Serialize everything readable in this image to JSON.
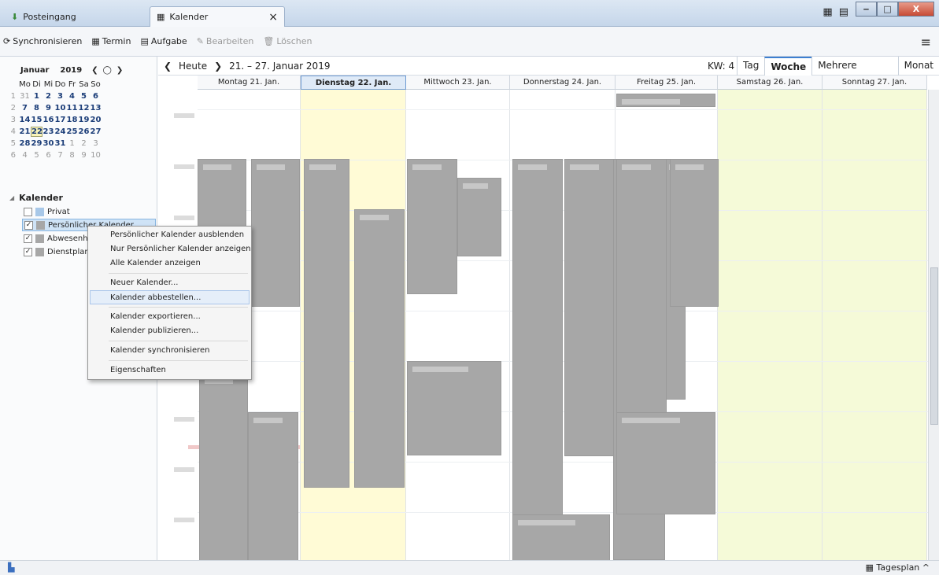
{
  "tabs": {
    "inbox": "Posteingang",
    "calendar": "Kalender",
    "close": "×"
  },
  "toolbar": {
    "sync": "Synchronisieren",
    "event": "Termin",
    "task": "Aufgabe",
    "edit": "Bearbeiten",
    "delete": "Löschen"
  },
  "minimonth": {
    "month": "Januar",
    "year": "2019",
    "weekdays": [
      "Mo",
      "Di",
      "Mi",
      "Do",
      "Fr",
      "Sa",
      "So"
    ],
    "weeks": [
      {
        "wk": "1",
        "days": [
          "31",
          "1",
          "2",
          "3",
          "4",
          "5",
          "6"
        ]
      },
      {
        "wk": "2",
        "days": [
          "7",
          "8",
          "9",
          "10",
          "11",
          "12",
          "13"
        ]
      },
      {
        "wk": "3",
        "days": [
          "14",
          "15",
          "16",
          "17",
          "18",
          "19",
          "20"
        ]
      },
      {
        "wk": "4",
        "days": [
          "21",
          "22",
          "23",
          "24",
          "25",
          "26",
          "27"
        ]
      },
      {
        "wk": "5",
        "days": [
          "28",
          "29",
          "30",
          "31",
          "1",
          "2",
          "3"
        ]
      },
      {
        "wk": "6",
        "days": [
          "4",
          "5",
          "6",
          "7",
          "8",
          "9",
          "10"
        ]
      }
    ]
  },
  "calendars": {
    "heading": "Kalender",
    "items": [
      {
        "label": "Privat",
        "checked": false,
        "color": "#a8c8e8"
      },
      {
        "label": "Persönlicher Kalender",
        "checked": true,
        "color": "#a7a7a7"
      },
      {
        "label": "Abwesenhe",
        "checked": true,
        "color": "#a7a7a7"
      },
      {
        "label": "Dienstplan",
        "checked": true,
        "color": "#a7a7a7"
      }
    ]
  },
  "context_menu": {
    "items": [
      "Persönlicher Kalender ausblenden",
      "Nur Persönlicher Kalender anzeigen",
      "Alle Kalender anzeigen",
      "Neuer Kalender...",
      "Kalender abbestellen...",
      "Kalender exportieren...",
      "Kalender publizieren...",
      "Kalender synchronisieren",
      "Eigenschaften"
    ]
  },
  "calnav": {
    "today": "Heute",
    "range": "21. – 27. Januar 2019",
    "kw": "KW: 4",
    "views": [
      "Tag",
      "Woche",
      "Mehrere Wochen",
      "Monat"
    ]
  },
  "days": [
    "Montag 21. Jan.",
    "Dienstag 22. Jan.",
    "Mittwoch 23. Jan.",
    "Donnerstag 24. Jan.",
    "Freitag 25. Jan.",
    "Samstag 26. Jan.",
    "Sonntag 27. Jan."
  ],
  "statusbar": {
    "dayplan": "Tagesplan ^"
  },
  "colors": {
    "weekend": "#f5fad8",
    "today_column": "#fffbd6",
    "event": "#a7a7a7",
    "accent": "#3d7fd1"
  }
}
